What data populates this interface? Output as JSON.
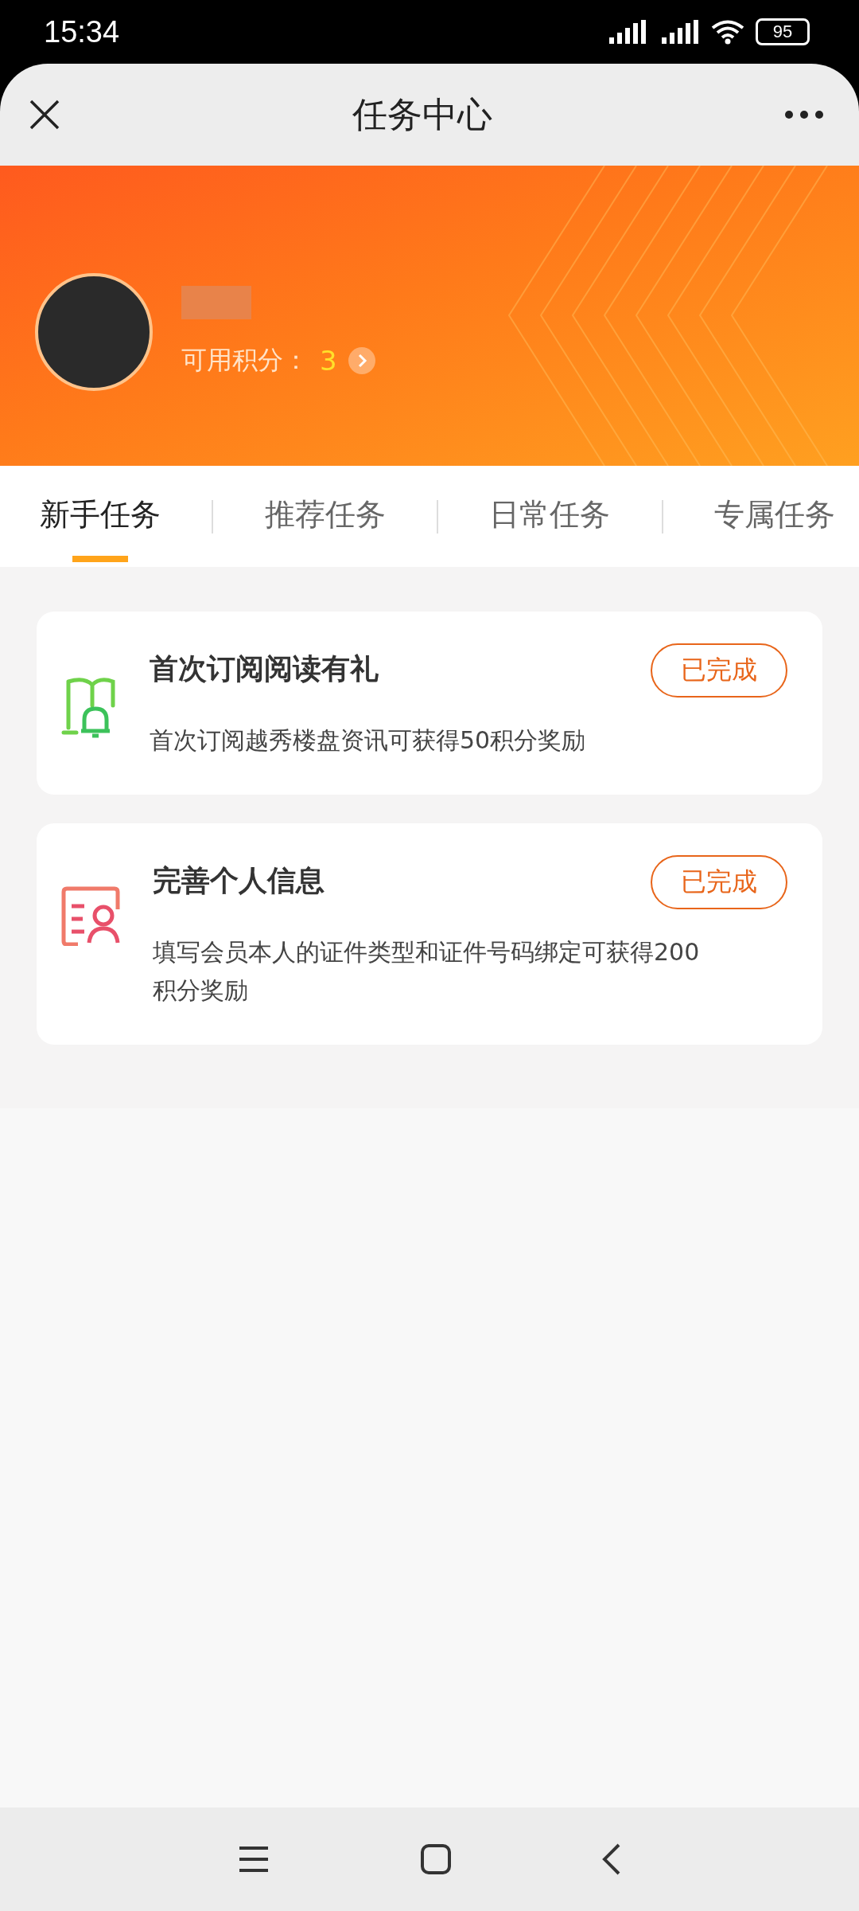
{
  "status_bar": {
    "time": "15:34",
    "battery": "95"
  },
  "header": {
    "title": "任务中心"
  },
  "profile": {
    "points_label": "可用积分：",
    "points": "3"
  },
  "tabs": [
    {
      "label": "新手任务",
      "selected": true
    },
    {
      "label": "推荐任务",
      "selected": false
    },
    {
      "label": "日常任务",
      "selected": false
    },
    {
      "label": "专属任务",
      "selected": false
    }
  ],
  "tasks": [
    {
      "kind": "subscribe",
      "title": "首次订阅阅读有礼",
      "description": "首次订阅越秀楼盘资讯可获得50积分奖励",
      "status": "已完成"
    },
    {
      "kind": "profile",
      "title": "完善个人信息",
      "description": "填写会员本人的证件类型和证件号码绑定可获得200积分奖励",
      "status": "已完成"
    }
  ]
}
